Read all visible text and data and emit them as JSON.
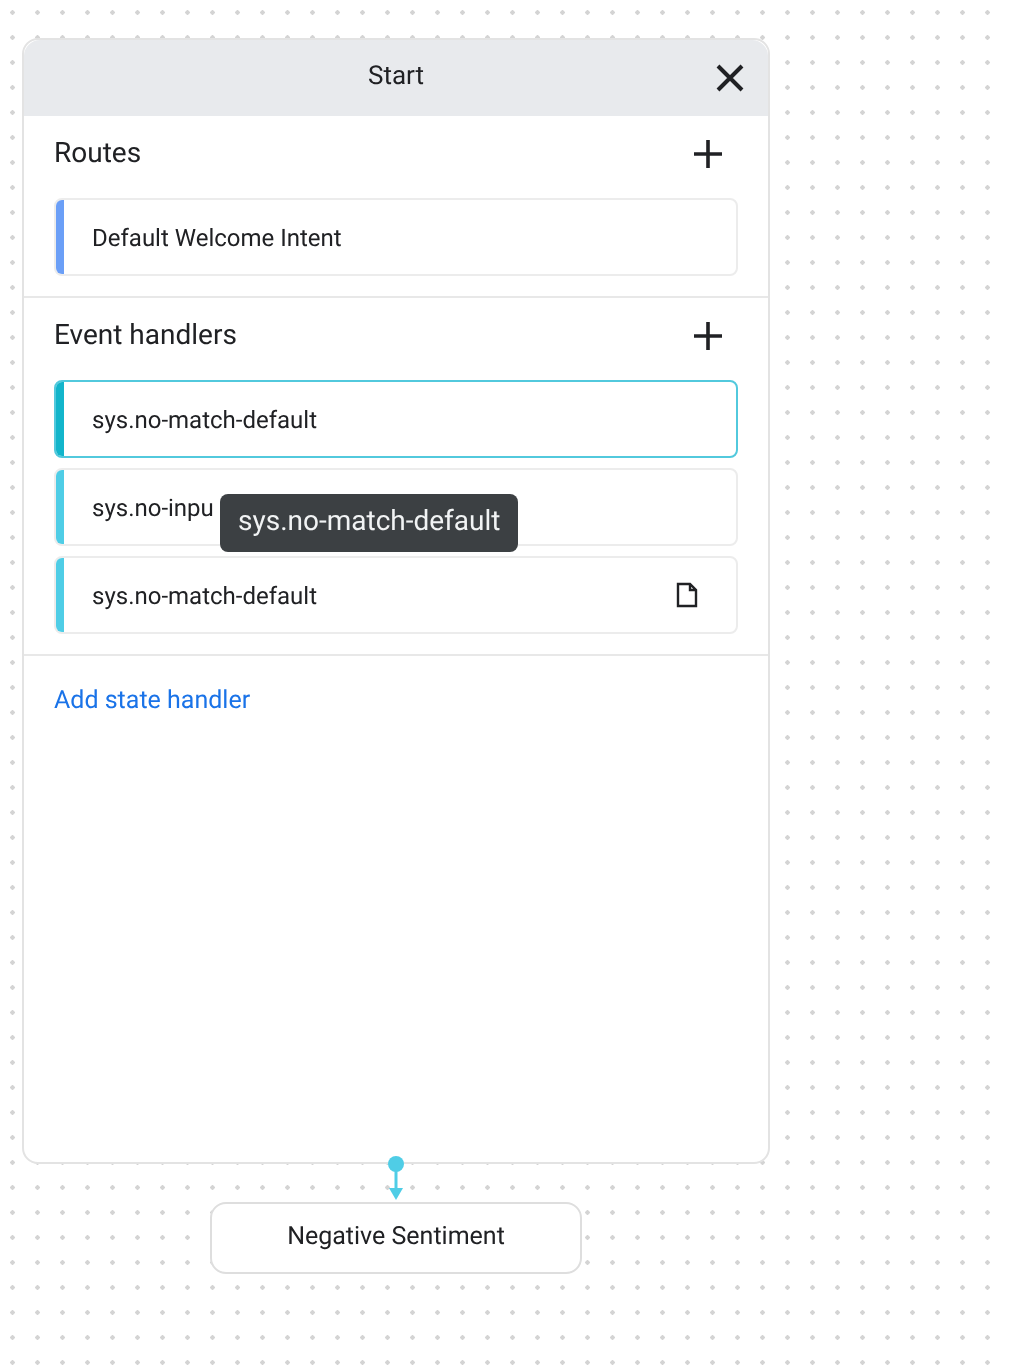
{
  "panel": {
    "title": "Start",
    "sections": [
      {
        "title": "Routes",
        "items": [
          {
            "label": "Default Welcome Intent",
            "selected": false,
            "attachment": false,
            "color": "#6b9ff7"
          }
        ]
      },
      {
        "title": "Event handlers",
        "items": [
          {
            "label": "sys.no-match-default",
            "selected": true,
            "attachment": false,
            "color": "#12b5cb"
          },
          {
            "label": "sys.no-inpu",
            "selected": false,
            "attachment": false,
            "color": "#4fcde6"
          },
          {
            "label": "sys.no-match-default",
            "selected": false,
            "attachment": true,
            "color": "#4fcde6"
          }
        ]
      }
    ],
    "link": "Add state handler"
  },
  "tooltip": {
    "text": "sys.no-match-default"
  },
  "next_node": {
    "label": "Negative Sentiment"
  }
}
